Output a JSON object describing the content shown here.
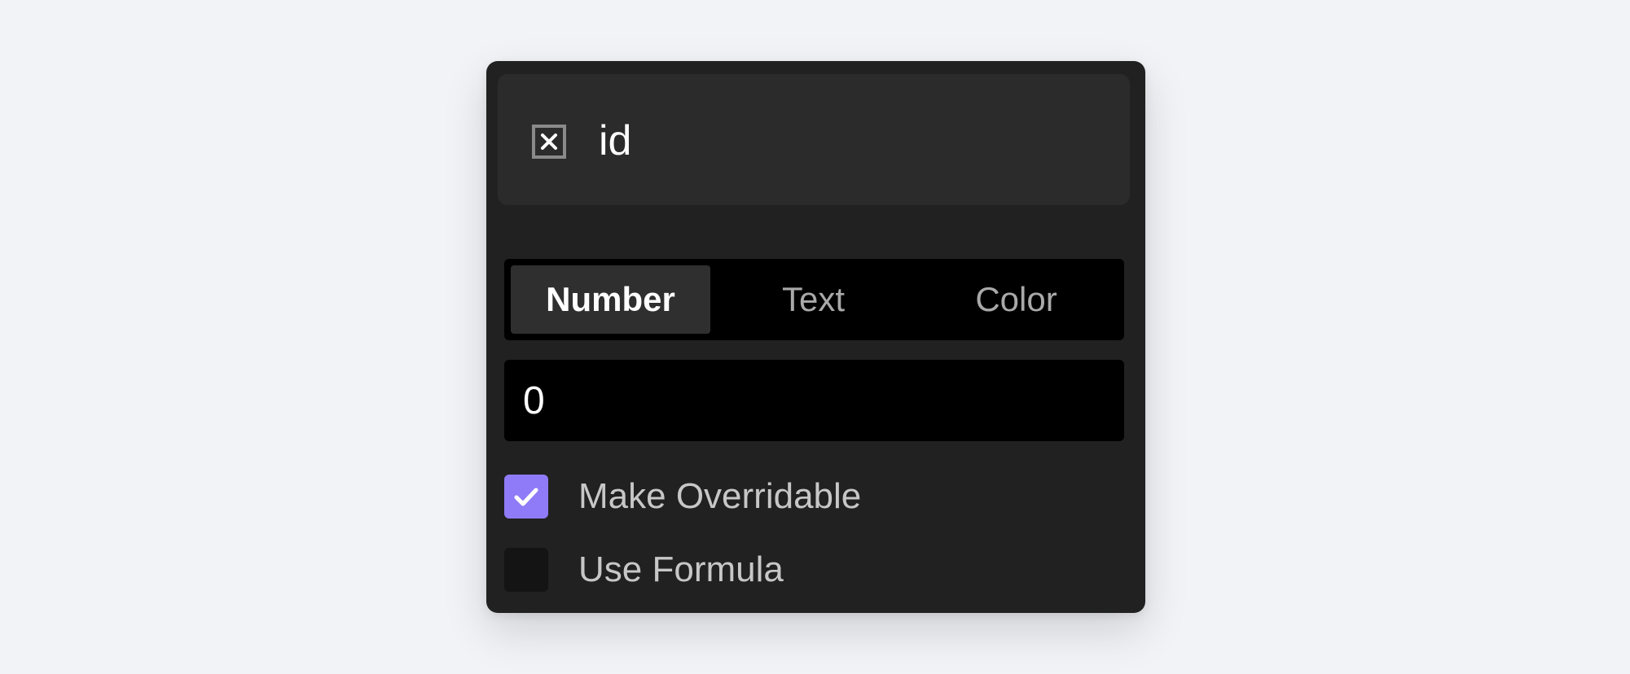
{
  "variable": {
    "icon": "variable-box-icon",
    "name": "id"
  },
  "type_selector": {
    "options": [
      "Number",
      "Text",
      "Color"
    ],
    "selected": "Number"
  },
  "value_input": {
    "value": "0"
  },
  "options": [
    {
      "label": "Make Overridable",
      "checked": true
    },
    {
      "label": "Use Formula",
      "checked": false
    }
  ],
  "colors": {
    "accent": "#8f7bf7",
    "panel_bg": "#212121",
    "header_bg": "#2b2b2b",
    "page_bg": "#f2f3f7"
  }
}
